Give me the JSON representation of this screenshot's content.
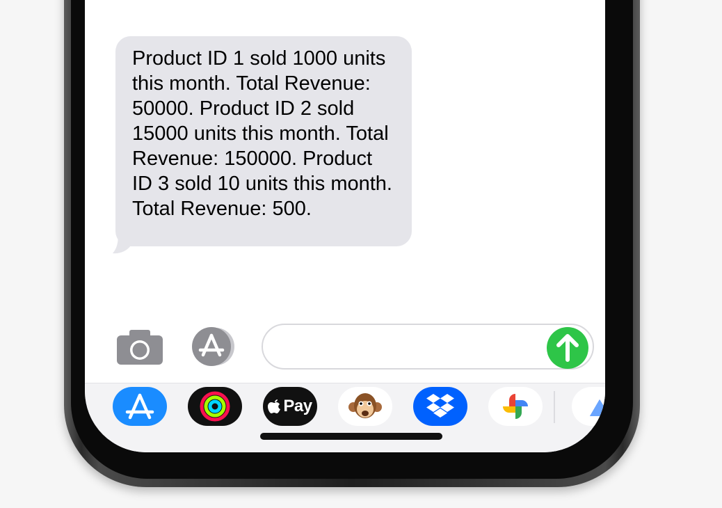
{
  "conversation": {
    "messages": [
      {
        "direction": "incoming",
        "text": "Product ID 1 sold 1000 units this month. Total Revenue: 50000. Product ID 2 sold 15000 units this month. Total Revenue: 150000. Product ID 3 sold 10 units this month. Total Revenue: 500."
      }
    ],
    "bubble_color": "#e5e5ea"
  },
  "composer": {
    "value": "",
    "placeholder": "",
    "send_color": "#2ec548",
    "icons": [
      "camera-icon",
      "app-store-icon",
      "send-arrow-icon"
    ]
  },
  "app_drawer": {
    "apps": [
      {
        "id": "app-store",
        "icon": "app-store-icon",
        "color": "#1a8cff"
      },
      {
        "id": "activity",
        "icon": "activity-rings-icon",
        "color": "#111111"
      },
      {
        "id": "apple-pay",
        "icon": "apple-pay-icon",
        "label": "Pay",
        "color": "#111111"
      },
      {
        "id": "animoji",
        "icon": "monkey-animoji-icon",
        "color": "#ffffff"
      },
      {
        "id": "dropbox",
        "icon": "dropbox-icon",
        "color": "#0061fe"
      },
      {
        "id": "google-photos",
        "icon": "pinwheel-icon",
        "color": "#ffffff"
      },
      {
        "id": "partial-app",
        "icon": "mountain-icon",
        "color": "#ffffff"
      }
    ]
  }
}
